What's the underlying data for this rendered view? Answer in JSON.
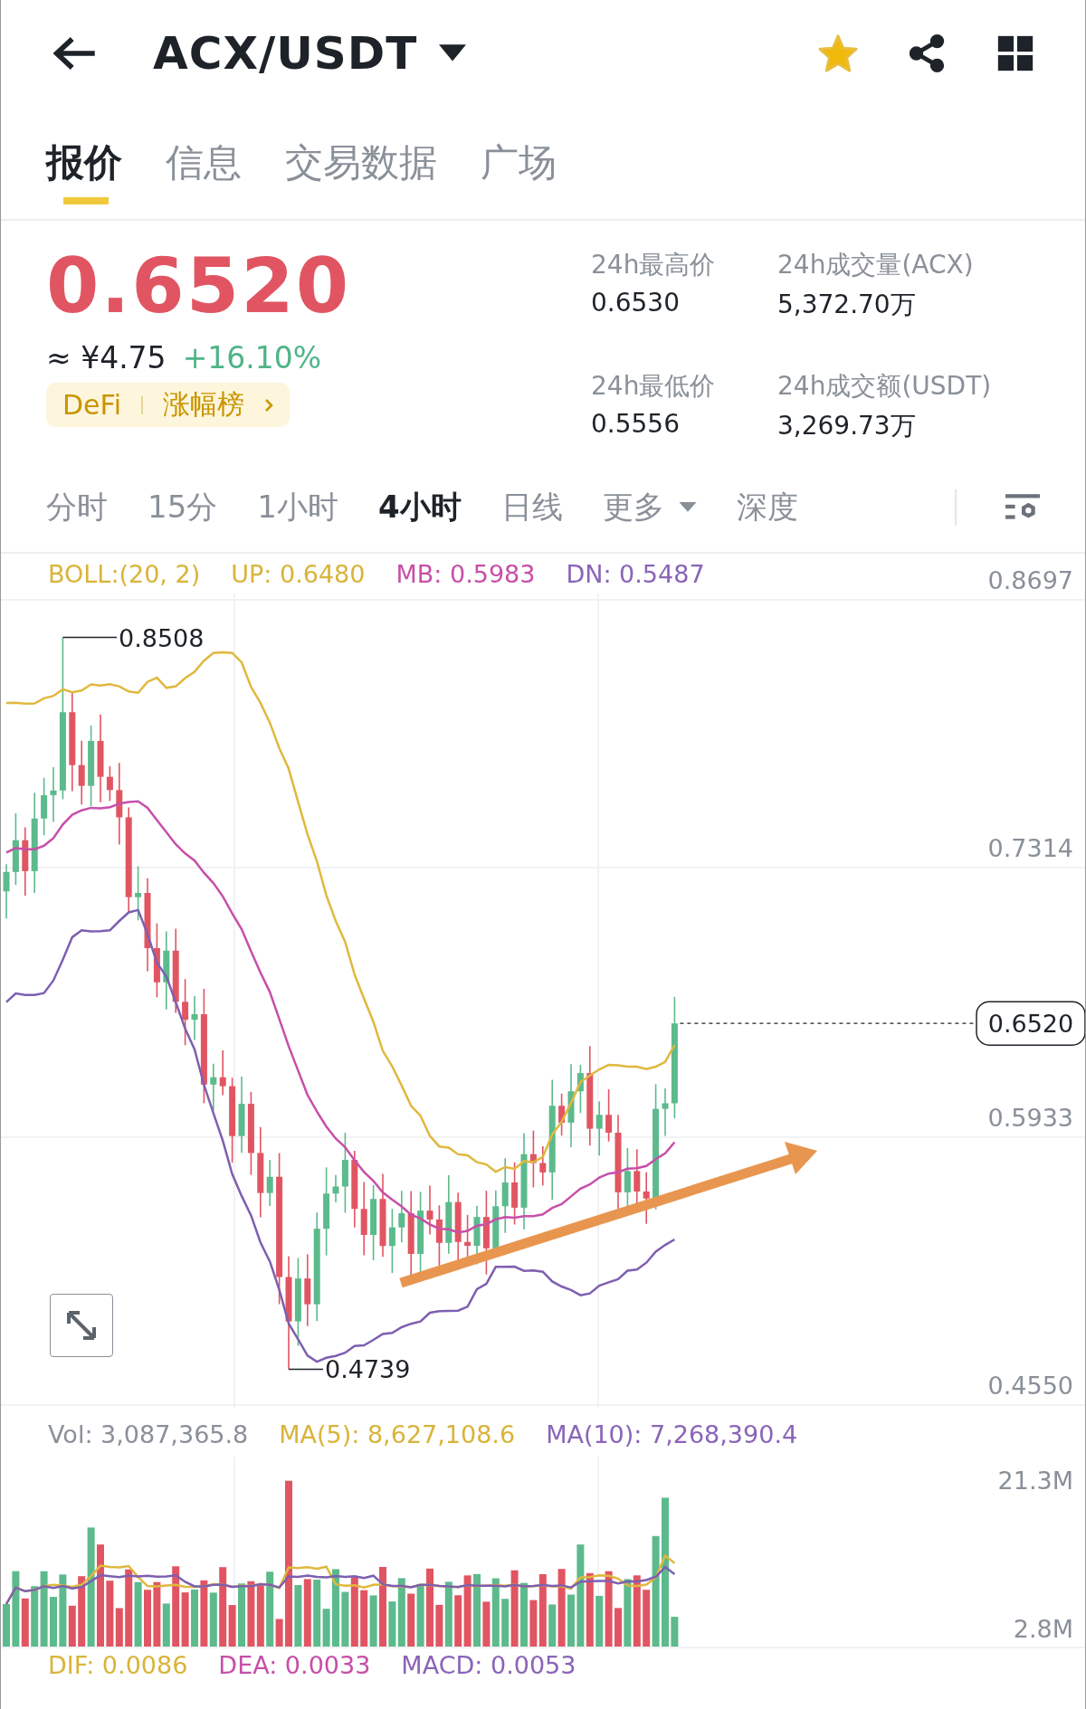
{
  "header": {
    "title": "ACX/USDT",
    "favorite": true
  },
  "tabs": [
    {
      "label": "报价",
      "selected": true
    },
    {
      "label": "信息",
      "selected": false
    },
    {
      "label": "交易数据",
      "selected": false
    },
    {
      "label": "广场",
      "selected": false
    }
  ],
  "price": {
    "last": "0.6520",
    "cny": "≈ ¥4.75",
    "change": "+16.10%",
    "tags": [
      "DeFi",
      "涨幅榜"
    ]
  },
  "stats": [
    {
      "label": "24h最高价",
      "value": "0.6530"
    },
    {
      "label": "24h成交量(ACX)",
      "value": "5,372.70万"
    },
    {
      "label": "24h最低价",
      "value": "0.5556"
    },
    {
      "label": "24h成交额(USDT)",
      "value": "3,269.73万"
    }
  ],
  "intervals": [
    {
      "label": "分时",
      "selected": false,
      "kind": "plain"
    },
    {
      "label": "15分",
      "selected": false,
      "kind": "plain"
    },
    {
      "label": "1小时",
      "selected": false,
      "kind": "plain"
    },
    {
      "label": "4小时",
      "selected": true,
      "kind": "plain"
    },
    {
      "label": "日线",
      "selected": false,
      "kind": "plain"
    },
    {
      "label": "更多",
      "selected": false,
      "kind": "dropdown"
    },
    {
      "label": "深度",
      "selected": false,
      "kind": "plain"
    }
  ],
  "boll_legend": [
    {
      "text": "BOLL:(20, 2)",
      "color": "#d9b43a"
    },
    {
      "text": "UP: 0.6480",
      "color": "#d9b43a"
    },
    {
      "text": "MB: 0.5983",
      "color": "#c74fa8"
    },
    {
      "text": "DN: 0.5487",
      "color": "#8a64b8"
    }
  ],
  "price_axis": [
    "0.8697",
    "0.7314",
    "0.5933",
    "0.4550"
  ],
  "high_marker": "0.8508",
  "low_marker": "0.4739",
  "current_price": "0.6520",
  "volume_legend": [
    {
      "text": "Vol: 3,087,365.8",
      "color": "#8a9099"
    },
    {
      "text": "MA(5): 8,627,108.6",
      "color": "#d9b43a"
    },
    {
      "text": "MA(10): 7,268,390.4",
      "color": "#8a64b8"
    }
  ],
  "volume_axis": [
    "21.3M",
    "2.8M"
  ],
  "macd_legend": [
    {
      "text": "DIF: 0.0086",
      "color": "#d9b43a"
    },
    {
      "text": "DEA: 0.0033",
      "color": "#c74fa8"
    },
    {
      "text": "MACD: 0.0053",
      "color": "#8a64b8"
    }
  ]
}
